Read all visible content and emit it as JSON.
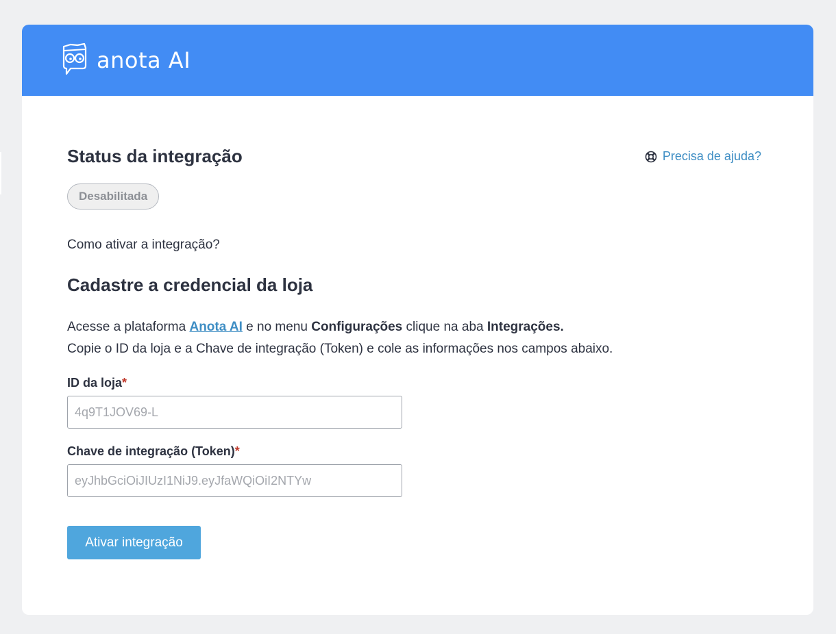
{
  "header": {
    "brand": "anota AI",
    "logo_icon": "owl-chat-icon",
    "background_color": "#428cf4"
  },
  "status": {
    "title": "Status da integração",
    "badge": "Desabilitada",
    "help_link": "Precisa de ajuda?",
    "help_icon": "lifebuoy-icon"
  },
  "guide": {
    "question": "Como ativar a integração?",
    "subtitle": "Cadastre a credencial da loja",
    "line1": {
      "prefix": "Acesse a plataforma ",
      "link": "Anota AI",
      "mid1": " e no menu ",
      "bold1": "Configurações",
      "mid2": " clique na aba ",
      "bold2": "Integrações."
    },
    "line2": "Copie o ID da loja e a Chave de integração (Token) e cole as informações nos campos abaixo."
  },
  "form": {
    "store_id": {
      "label": "ID da loja",
      "required_mark": "*",
      "placeholder": "4q9T1JOV69-L",
      "value": ""
    },
    "token": {
      "label": "Chave de integração (Token)",
      "required_mark": "*",
      "placeholder": "eyJhbGciOiJIUzI1NiJ9.eyJfaWQiOiI2NTYw",
      "value": ""
    },
    "submit_label": "Ativar integração",
    "accent_color": "#4fa6dd"
  }
}
